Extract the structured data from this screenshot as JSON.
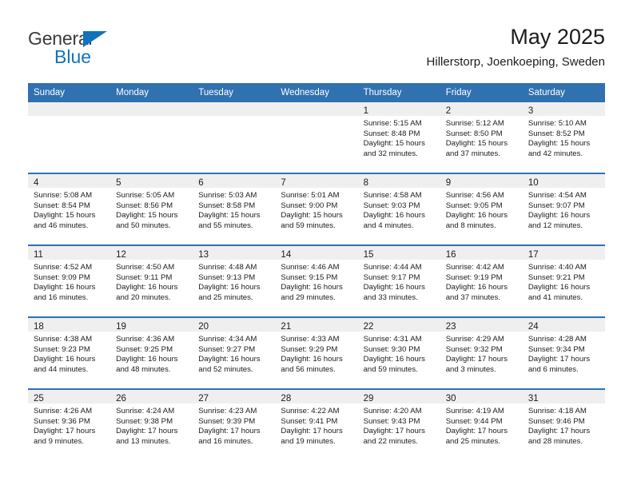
{
  "brand": {
    "name_top": "General",
    "name_bottom": "Blue",
    "triangle_color": "#1272bb",
    "text_color": "#3b3b3b"
  },
  "header": {
    "title": "May 2025",
    "subtitle": "Hillerstorp, Joenkoeping, Sweden"
  },
  "theme": {
    "header_blue": "#3071b0",
    "daynum_band": "#efefef",
    "text": "#1c1c1c"
  },
  "weekday_headers": [
    "Sunday",
    "Monday",
    "Tuesday",
    "Wednesday",
    "Thursday",
    "Friday",
    "Saturday"
  ],
  "weeks": [
    [
      {
        "day": "",
        "lines": []
      },
      {
        "day": "",
        "lines": []
      },
      {
        "day": "",
        "lines": []
      },
      {
        "day": "",
        "lines": []
      },
      {
        "day": "1",
        "lines": [
          "Sunrise: 5:15 AM",
          "Sunset: 8:48 PM",
          "Daylight: 15 hours",
          "and 32 minutes."
        ]
      },
      {
        "day": "2",
        "lines": [
          "Sunrise: 5:12 AM",
          "Sunset: 8:50 PM",
          "Daylight: 15 hours",
          "and 37 minutes."
        ]
      },
      {
        "day": "3",
        "lines": [
          "Sunrise: 5:10 AM",
          "Sunset: 8:52 PM",
          "Daylight: 15 hours",
          "and 42 minutes."
        ]
      }
    ],
    [
      {
        "day": "4",
        "lines": [
          "Sunrise: 5:08 AM",
          "Sunset: 8:54 PM",
          "Daylight: 15 hours",
          "and 46 minutes."
        ]
      },
      {
        "day": "5",
        "lines": [
          "Sunrise: 5:05 AM",
          "Sunset: 8:56 PM",
          "Daylight: 15 hours",
          "and 50 minutes."
        ]
      },
      {
        "day": "6",
        "lines": [
          "Sunrise: 5:03 AM",
          "Sunset: 8:58 PM",
          "Daylight: 15 hours",
          "and 55 minutes."
        ]
      },
      {
        "day": "7",
        "lines": [
          "Sunrise: 5:01 AM",
          "Sunset: 9:00 PM",
          "Daylight: 15 hours",
          "and 59 minutes."
        ]
      },
      {
        "day": "8",
        "lines": [
          "Sunrise: 4:58 AM",
          "Sunset: 9:03 PM",
          "Daylight: 16 hours",
          "and 4 minutes."
        ]
      },
      {
        "day": "9",
        "lines": [
          "Sunrise: 4:56 AM",
          "Sunset: 9:05 PM",
          "Daylight: 16 hours",
          "and 8 minutes."
        ]
      },
      {
        "day": "10",
        "lines": [
          "Sunrise: 4:54 AM",
          "Sunset: 9:07 PM",
          "Daylight: 16 hours",
          "and 12 minutes."
        ]
      }
    ],
    [
      {
        "day": "11",
        "lines": [
          "Sunrise: 4:52 AM",
          "Sunset: 9:09 PM",
          "Daylight: 16 hours",
          "and 16 minutes."
        ]
      },
      {
        "day": "12",
        "lines": [
          "Sunrise: 4:50 AM",
          "Sunset: 9:11 PM",
          "Daylight: 16 hours",
          "and 20 minutes."
        ]
      },
      {
        "day": "13",
        "lines": [
          "Sunrise: 4:48 AM",
          "Sunset: 9:13 PM",
          "Daylight: 16 hours",
          "and 25 minutes."
        ]
      },
      {
        "day": "14",
        "lines": [
          "Sunrise: 4:46 AM",
          "Sunset: 9:15 PM",
          "Daylight: 16 hours",
          "and 29 minutes."
        ]
      },
      {
        "day": "15",
        "lines": [
          "Sunrise: 4:44 AM",
          "Sunset: 9:17 PM",
          "Daylight: 16 hours",
          "and 33 minutes."
        ]
      },
      {
        "day": "16",
        "lines": [
          "Sunrise: 4:42 AM",
          "Sunset: 9:19 PM",
          "Daylight: 16 hours",
          "and 37 minutes."
        ]
      },
      {
        "day": "17",
        "lines": [
          "Sunrise: 4:40 AM",
          "Sunset: 9:21 PM",
          "Daylight: 16 hours",
          "and 41 minutes."
        ]
      }
    ],
    [
      {
        "day": "18",
        "lines": [
          "Sunrise: 4:38 AM",
          "Sunset: 9:23 PM",
          "Daylight: 16 hours",
          "and 44 minutes."
        ]
      },
      {
        "day": "19",
        "lines": [
          "Sunrise: 4:36 AM",
          "Sunset: 9:25 PM",
          "Daylight: 16 hours",
          "and 48 minutes."
        ]
      },
      {
        "day": "20",
        "lines": [
          "Sunrise: 4:34 AM",
          "Sunset: 9:27 PM",
          "Daylight: 16 hours",
          "and 52 minutes."
        ]
      },
      {
        "day": "21",
        "lines": [
          "Sunrise: 4:33 AM",
          "Sunset: 9:29 PM",
          "Daylight: 16 hours",
          "and 56 minutes."
        ]
      },
      {
        "day": "22",
        "lines": [
          "Sunrise: 4:31 AM",
          "Sunset: 9:30 PM",
          "Daylight: 16 hours",
          "and 59 minutes."
        ]
      },
      {
        "day": "23",
        "lines": [
          "Sunrise: 4:29 AM",
          "Sunset: 9:32 PM",
          "Daylight: 17 hours",
          "and 3 minutes."
        ]
      },
      {
        "day": "24",
        "lines": [
          "Sunrise: 4:28 AM",
          "Sunset: 9:34 PM",
          "Daylight: 17 hours",
          "and 6 minutes."
        ]
      }
    ],
    [
      {
        "day": "25",
        "lines": [
          "Sunrise: 4:26 AM",
          "Sunset: 9:36 PM",
          "Daylight: 17 hours",
          "and 9 minutes."
        ]
      },
      {
        "day": "26",
        "lines": [
          "Sunrise: 4:24 AM",
          "Sunset: 9:38 PM",
          "Daylight: 17 hours",
          "and 13 minutes."
        ]
      },
      {
        "day": "27",
        "lines": [
          "Sunrise: 4:23 AM",
          "Sunset: 9:39 PM",
          "Daylight: 17 hours",
          "and 16 minutes."
        ]
      },
      {
        "day": "28",
        "lines": [
          "Sunrise: 4:22 AM",
          "Sunset: 9:41 PM",
          "Daylight: 17 hours",
          "and 19 minutes."
        ]
      },
      {
        "day": "29",
        "lines": [
          "Sunrise: 4:20 AM",
          "Sunset: 9:43 PM",
          "Daylight: 17 hours",
          "and 22 minutes."
        ]
      },
      {
        "day": "30",
        "lines": [
          "Sunrise: 4:19 AM",
          "Sunset: 9:44 PM",
          "Daylight: 17 hours",
          "and 25 minutes."
        ]
      },
      {
        "day": "31",
        "lines": [
          "Sunrise: 4:18 AM",
          "Sunset: 9:46 PM",
          "Daylight: 17 hours",
          "and 28 minutes."
        ]
      }
    ]
  ]
}
